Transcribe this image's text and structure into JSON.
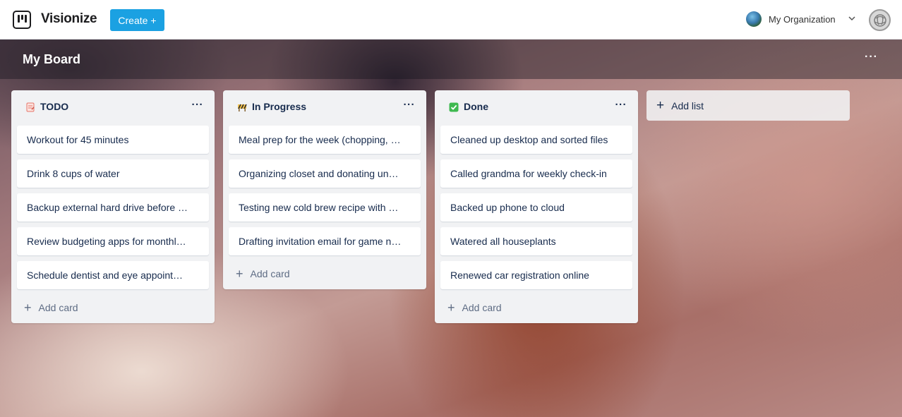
{
  "app": {
    "brand": "Visionize",
    "create_label": "Create",
    "create_icon": "+",
    "organization": "My Organization",
    "org_chevron": "⌄"
  },
  "board": {
    "title": "My Board",
    "menu_icon": "···"
  },
  "lists": [
    {
      "title": "TODO",
      "icon": "memo-icon",
      "icon_color": "#f0857a",
      "menu_icon": "···",
      "cards": [
        "Workout for 45 minutes",
        "Drink 8 cups of water",
        "Backup external hard drive before …",
        "Review budgeting apps for monthl…",
        "Schedule dentist and eye appoint…"
      ],
      "add_card_label": "Add card"
    },
    {
      "title": "In Progress",
      "icon": "construction-icon",
      "icon_color": "#e8a33a",
      "menu_icon": "···",
      "cards": [
        "Meal prep for the week (chopping, …",
        "Organizing closet and donating un…",
        "Testing new cold brew recipe with …",
        "Drafting invitation email for game n…"
      ],
      "add_card_label": "Add card"
    },
    {
      "title": "Done",
      "icon": "check-icon",
      "icon_color": "#3fb950",
      "menu_icon": "···",
      "cards": [
        "Cleaned up desktop and sorted files",
        "Called grandma for weekly check-in",
        "Backed up phone to cloud",
        "Watered all houseplants",
        "Renewed car registration online"
      ],
      "add_card_label": "Add card"
    }
  ],
  "add_list_label": "Add list",
  "plus_glyph": "+"
}
